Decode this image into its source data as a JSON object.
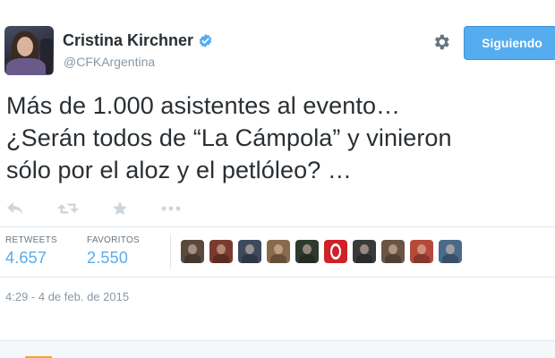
{
  "author": {
    "name": "Cristina Kirchner",
    "handle": "@CFKArgentina",
    "avatar_icon": "profile-photo",
    "verified_icon": "verified-badge-icon"
  },
  "follow_button": {
    "label": "Siguiendo"
  },
  "tweet": {
    "text": "Más de 1.000 asistentes al evento…\n¿Serán todos de “La Cámpola” y vinieron\nsólo por el aloz y el petlóleo? …",
    "timestamp": "4:29 - 4 de feb. de 2015"
  },
  "actions": [
    {
      "name": "reply-icon"
    },
    {
      "name": "retweet-icon"
    },
    {
      "name": "favorite-icon"
    },
    {
      "name": "more-icon"
    }
  ],
  "stats": {
    "retweets_label": "RETWEETS",
    "retweets_value": "4.657",
    "favorites_label": "FAVORITOS",
    "favorites_value": "2.550"
  },
  "favoriters": [
    {
      "name": "favoriter-avatar-1",
      "color": "#5a4a3e"
    },
    {
      "name": "favoriter-avatar-2",
      "color": "#7a3b2e"
    },
    {
      "name": "favoriter-avatar-3",
      "color": "#3d4a5c"
    },
    {
      "name": "favoriter-avatar-4",
      "color": "#8a6a4a"
    },
    {
      "name": "favoriter-avatar-5",
      "color": "#2f3a2f"
    },
    {
      "name": "favoriter-avatar-6",
      "color": "#d0202a"
    },
    {
      "name": "favoriter-avatar-7",
      "color": "#3a3a3a"
    },
    {
      "name": "favoriter-avatar-8",
      "color": "#6b5444"
    },
    {
      "name": "favoriter-avatar-9",
      "color": "#b54a3a"
    },
    {
      "name": "favoriter-avatar-10",
      "color": "#4a6a8a"
    }
  ],
  "colors": {
    "accent": "#55acee",
    "text": "#292f33",
    "muted": "#8899a6",
    "divider": "#e1e8ed"
  }
}
